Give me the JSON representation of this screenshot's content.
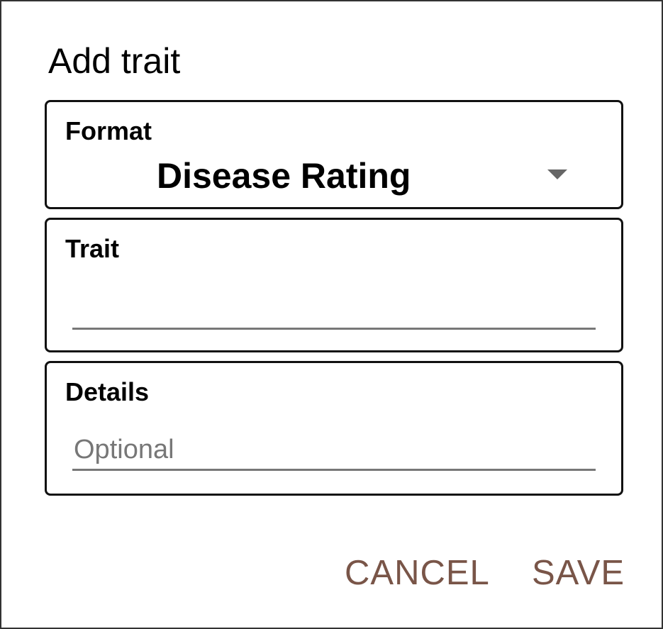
{
  "dialog": {
    "title": "Add trait"
  },
  "format_field": {
    "label": "Format",
    "selected_value": "Disease Rating",
    "arrow_icon": "dropdown-arrow-icon"
  },
  "trait_field": {
    "label": "Trait",
    "value": "",
    "placeholder": ""
  },
  "details_field": {
    "label": "Details",
    "value": "",
    "placeholder": "Optional"
  },
  "actions": {
    "cancel_label": "CANCEL",
    "save_label": "SAVE"
  },
  "colors": {
    "button_text": "#795548",
    "underline": "#777777",
    "border": "#111111"
  }
}
